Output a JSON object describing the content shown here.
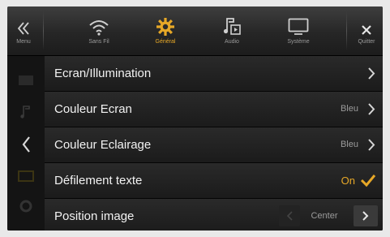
{
  "topbar": {
    "menu": {
      "label": "Menu",
      "icon": "chevron-left-double-icon"
    },
    "wireless": {
      "label": "Sans Fil",
      "icon": "wifi-icon"
    },
    "general": {
      "label": "Général",
      "icon": "gear-icon"
    },
    "audio": {
      "label": "Audio",
      "icon": "music-note-icon"
    },
    "system": {
      "label": "Système",
      "icon": "monitor-icon"
    },
    "quit": {
      "label": "Quitter",
      "icon": "close-icon"
    }
  },
  "settings": {
    "screen_lighting": {
      "label": "Ecran/Illumination"
    },
    "screen_color": {
      "label": "Couleur Ecran",
      "value": "Bleu"
    },
    "lighting_color": {
      "label": "Couleur Eclairage",
      "value": "Bleu"
    },
    "text_scroll": {
      "label": "Défilement texte",
      "value": "On",
      "checked": true
    },
    "image_position": {
      "label": "Position image",
      "value": "Center"
    }
  },
  "colors": {
    "accent": "#e7a827",
    "background": "#101010",
    "text": "#f2f2f2"
  }
}
